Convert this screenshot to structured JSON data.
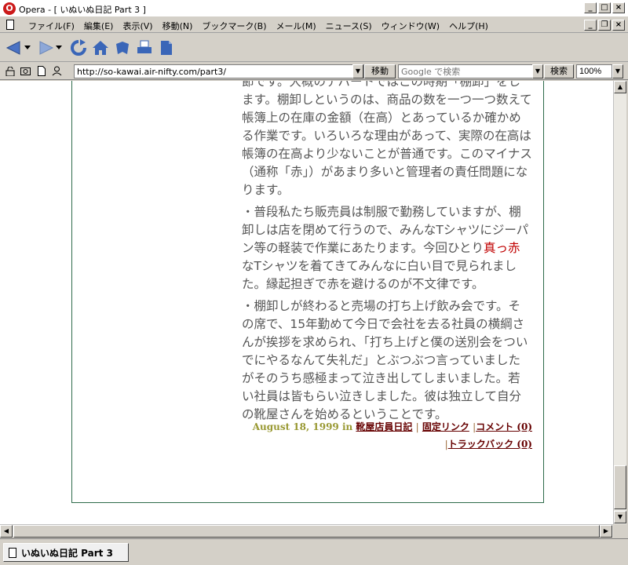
{
  "window": {
    "title": "Opera - [ いぬいぬ日記 Part 3 ]",
    "app_icon": "opera-logo-icon",
    "controls": [
      "minimize-icon",
      "maximize-icon",
      "close-icon"
    ]
  },
  "menu": {
    "items": [
      "ファイル(F)",
      "編集(E)",
      "表示(V)",
      "移動(N)",
      "ブックマーク(B)",
      "メール(M)",
      "ニュース(S)",
      "ウィンドウ(W)",
      "ヘルプ(H)"
    ]
  },
  "toolbar": {
    "buttons": [
      "back-arrow-icon",
      "forward-arrow-icon",
      "reload-icon",
      "home-icon",
      "hotlist-icon",
      "print-icon",
      "document-icon"
    ]
  },
  "address_bar": {
    "url": "http://so-kawai.air-nifty.com/part3/",
    "go_label": "移動",
    "search_placeholder": "Google で検索",
    "search_button": "検索",
    "zoom": "100%"
  },
  "post": {
    "paragraph1": "節です。大概のデパートではこの時期「棚卸」をします。棚卸しというのは、商品の数を一つ一つ数えて帳簿上の在庫の金額（在高）とあっているか確かめる作業です。いろいろな理由があって、実際の在高は帳簿の在高より少ないことが普通です。このマイナス（通称「赤」）があまり多いと管理者の責任問題になります。",
    "paragraph2_a": "・普段私たち販売員は制服で勤務していますが、棚卸しは店を閉めて行うので、みんなTシャツにジーパン等の軽装で作業にあたります。今回ひとり",
    "paragraph2_red": "真っ赤",
    "paragraph2_b": "なTシャツを着てきてみんなに白い目で見られました。縁起担ぎで赤を避けるのが不文律です。",
    "paragraph3": "・棚卸しが終わると売場の打ち上げ飲み会です。その席で、15年勤めて今日で会社を去る社員の横綱さんが挨拶を求められ、「打ち上げと僕の送別会をついでにやるなんて失礼だ」とぶつぶつ言っていましたがそのうち感極まって泣き出してしまいました。若い社員は皆もらい泣きしました。彼は独立して自分の靴屋さんを始めるということです。",
    "footer": {
      "date": "August 18, 1999 in",
      "category": "靴屋店員日記",
      "permalink": "固定リンク",
      "comments": "コメント (0)",
      "trackback": "トラックバック (0)"
    }
  },
  "tabs": {
    "active": "いぬいぬ日記 Part 3"
  }
}
